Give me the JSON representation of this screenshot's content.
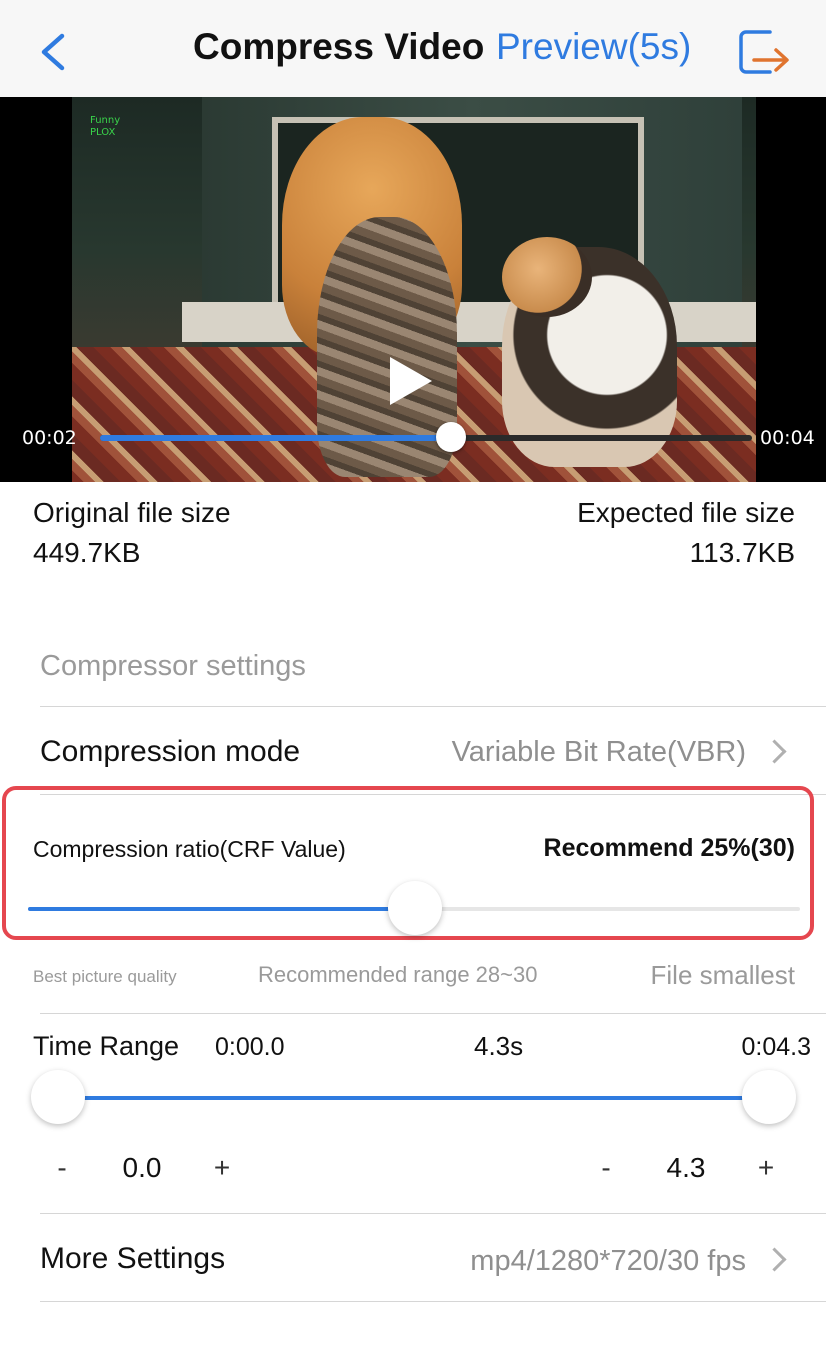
{
  "header": {
    "title": "Compress Video",
    "preview_label": "Preview(5s)",
    "back_icon": "chevron-left-icon",
    "export_icon": "export-arrow-icon",
    "accent_color": "#2f7be0",
    "export_color": "#e0742f"
  },
  "video": {
    "current_time": "00:02",
    "duration": "00:04",
    "progress": 0.54,
    "watermark": "Funny\nPLOX"
  },
  "file_size": {
    "original_label": "Original file size",
    "original_value": "449.7KB",
    "expected_label": "Expected file size",
    "expected_value": "113.7KB"
  },
  "settings": {
    "section_title": "Compressor settings",
    "compression_mode_label": "Compression mode",
    "compression_mode_value": "Variable Bit Rate(VBR)",
    "ratio_label": "Compression ratio(CRF Value)",
    "ratio_recommend": "Recommend 25%(30)",
    "ratio_slider_value": 0.5,
    "best_quality_label": "Best picture quality",
    "recommended_range_label": "Recommended range 28~30",
    "smallest_label": "File smallest",
    "highlight_color": "#e5474f"
  },
  "time_range": {
    "label": "Time Range",
    "start": "0:00.0",
    "duration": "4.3s",
    "end": "0:04.3",
    "start_value": "0.0",
    "end_value": "4.3",
    "minus": "-",
    "plus": "+"
  },
  "more_settings": {
    "label": "More Settings",
    "value": "mp4/1280*720/30 fps"
  }
}
